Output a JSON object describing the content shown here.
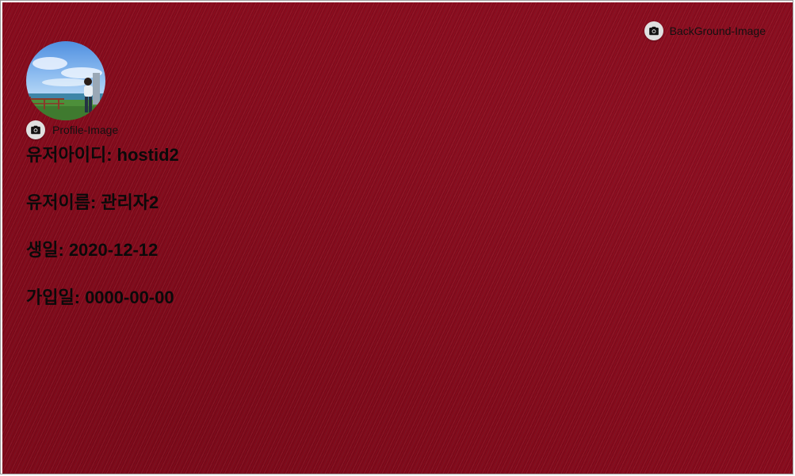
{
  "background_upload": {
    "label": "BackGround-Image",
    "icon": "camera-icon"
  },
  "profile_upload": {
    "label": "Profile-Image",
    "icon": "camera-icon"
  },
  "user_info": [
    {
      "label": "유저아이디",
      "value": "hostid2"
    },
    {
      "label": "유저이름",
      "value": "관리자2"
    },
    {
      "label": "생일",
      "value": "2020-12-12"
    },
    {
      "label": "가입일",
      "value": "0000-00-00"
    }
  ],
  "colors": {
    "background": "#8a0c1e",
    "button_bg": "#e0e0e0",
    "text": "#0a0a0a"
  }
}
